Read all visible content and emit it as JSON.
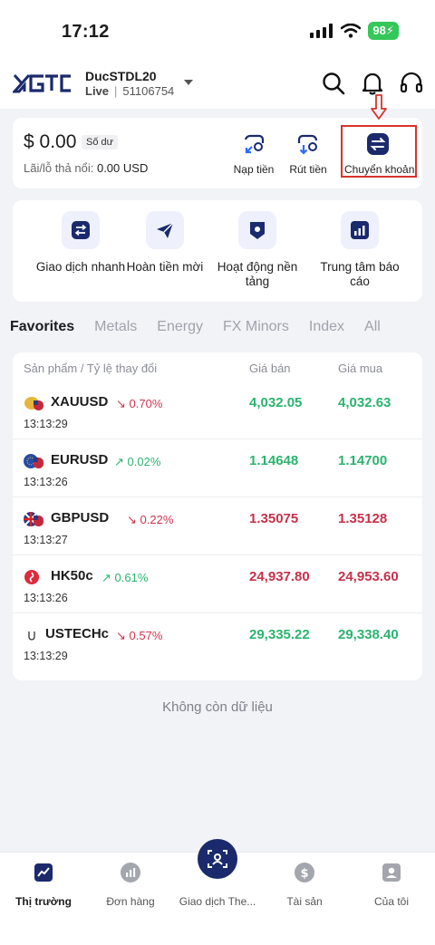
{
  "status_bar": {
    "time": "17:12",
    "battery": "98"
  },
  "header": {
    "account_name": "DucSTDL20",
    "account_type": "Live",
    "account_sep": "|",
    "account_number": "51106754"
  },
  "balance": {
    "amount": "$ 0.00",
    "tag": "Số dư",
    "pnl_label": "Lãi/lỗ thả nổi:",
    "pnl_value": "0.00",
    "pnl_currency": "USD",
    "actions": [
      {
        "label": "Nạp tiền",
        "icon": "deposit-icon"
      },
      {
        "label": "Rút tiền",
        "icon": "withdraw-icon"
      },
      {
        "label": "Chuyển khoản",
        "icon": "transfer-icon"
      }
    ]
  },
  "quick_actions": [
    {
      "label": "Giao dịch nhanh",
      "icon": "quick-trade-icon"
    },
    {
      "label": "Hoàn tiền mời",
      "icon": "send-icon"
    },
    {
      "label": "Hoạt động nền tảng",
      "icon": "shield-icon"
    },
    {
      "label": "Trung tâm báo cáo",
      "icon": "report-icon"
    }
  ],
  "tabs": [
    "Favorites",
    "Metals",
    "Energy",
    "FX Minors",
    "Index",
    "All"
  ],
  "table": {
    "headers": {
      "product": "Sản phẩm / Tỷ lệ thay đổi",
      "sell": "Giá bán",
      "buy": "Giá mua"
    },
    "rows": [
      {
        "symbol": "XAUUSD",
        "change": "0.70%",
        "direction": "down",
        "time": "13:13:29",
        "sell": "4,032.05",
        "buy": "4,032.63",
        "price_color": "green",
        "flag_icon": "gold-usd-icon"
      },
      {
        "symbol": "EURUSD",
        "change": "0.02%",
        "direction": "up",
        "time": "13:13:26",
        "sell": "1.14648",
        "buy": "1.14700",
        "price_color": "green",
        "flag_icon": "eu-usd-flag-icon"
      },
      {
        "symbol": "GBPUSD",
        "change": "0.22%",
        "direction": "down",
        "time": "13:13:27",
        "sell": "1.35075",
        "buy": "1.35128",
        "price_color": "red",
        "flag_icon": "gb-usd-flag-icon"
      },
      {
        "symbol": "HK50c",
        "change": "0.61%",
        "direction": "up",
        "time": "13:13:26",
        "sell": "24,937.80",
        "buy": "24,953.60",
        "price_color": "red",
        "flag_icon": "hk-flag-icon"
      },
      {
        "symbol": "USTECHc",
        "change": "0.57%",
        "direction": "down",
        "time": "13:13:29",
        "sell": "29,335.22",
        "buy": "29,338.40",
        "price_color": "green",
        "flag_icon": "us-index-icon"
      }
    ]
  },
  "no_more_text": "Không còn dữ liệu",
  "bottom_nav": [
    {
      "label": "Thị trường",
      "icon": "market-chart-icon",
      "active": true
    },
    {
      "label": "Đơn hàng",
      "icon": "orders-icon",
      "active": false
    },
    {
      "label": "Giao dịch The...",
      "icon": "copy-trade-icon",
      "active": false
    },
    {
      "label": "Tài sản",
      "icon": "assets-icon",
      "active": false
    },
    {
      "label": "Của tôi",
      "icon": "profile-icon",
      "active": false
    }
  ],
  "colors": {
    "up": "#2ab46e",
    "down": "#d43450",
    "accent": "#1a2a6c",
    "highlight": "#d9332b"
  }
}
